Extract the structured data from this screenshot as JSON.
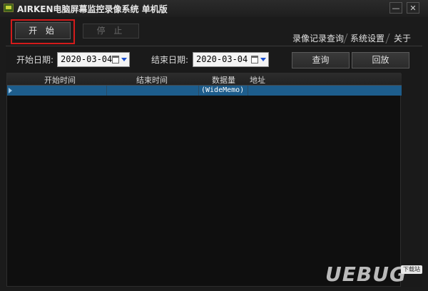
{
  "window": {
    "title": "AIRKEN电脑屏幕监控录像系统 单机版",
    "minimize_glyph": "—",
    "close_glyph": "✕"
  },
  "toolbar": {
    "start_label": "开 始",
    "stop_label": "停 止"
  },
  "tabs": [
    {
      "label": "录像记录查询"
    },
    {
      "label": "系统设置"
    },
    {
      "label": "关于"
    }
  ],
  "filters": {
    "start_date_label": "开始日期:",
    "start_date_value": "2020-03-04",
    "end_date_label": "结束日期:",
    "end_date_value": "2020-03-04",
    "query_label": "查询",
    "playback_label": "回放"
  },
  "grid": {
    "columns": [
      "开始时间",
      "结束时间",
      "数据量",
      "地址"
    ],
    "rows": [
      {
        "start": "",
        "end": "",
        "size": "(WideMemo)",
        "address": ""
      }
    ]
  },
  "watermark": {
    "text": "UEBUG",
    "badge": "下载站"
  },
  "colors": {
    "highlight_border": "#d41b1b",
    "selected_row": "#1d5d8c",
    "dropdown_arrow": "#1a4fd0"
  }
}
